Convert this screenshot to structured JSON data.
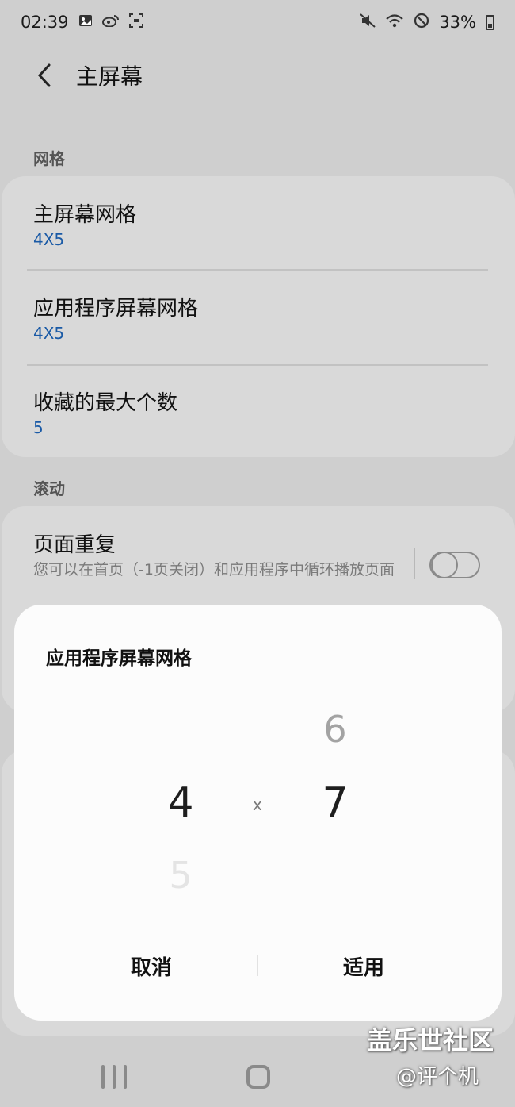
{
  "status_bar": {
    "time": "02:39",
    "battery": "33%",
    "left_icons": [
      "gallery-icon",
      "weibo-icon",
      "screenshot-icon"
    ],
    "right_icons": [
      "mute-icon",
      "wifi-icon",
      "dnd-icon",
      "battery-icon"
    ]
  },
  "header": {
    "title": "主屏幕"
  },
  "sections": {
    "grid": {
      "label": "网格",
      "items": [
        {
          "title": "主屏幕网格",
          "value": "4X5"
        },
        {
          "title": "应用程序屏幕网格",
          "value": "4X5"
        },
        {
          "title": "收藏的最大个数",
          "value": "5"
        }
      ]
    },
    "scroll": {
      "label": "滚动",
      "items": [
        {
          "title": "页面重复",
          "description": "您可以在首页（-1页关闭）和应用程序中循环播放页面",
          "toggle_on": false
        }
      ]
    }
  },
  "dialog": {
    "title": "应用程序屏幕网格",
    "columns": {
      "selected": "4",
      "below": "5"
    },
    "separator": "x",
    "rows": {
      "above": "6",
      "selected": "7"
    },
    "cancel_label": "取消",
    "apply_label": "适用"
  },
  "watermark": {
    "main": "盖乐世社区",
    "sub": "@评个机"
  },
  "colors": {
    "accent": "#1a5aa6",
    "background": "#cfcfcf",
    "dialog": "#fcfcfc"
  }
}
